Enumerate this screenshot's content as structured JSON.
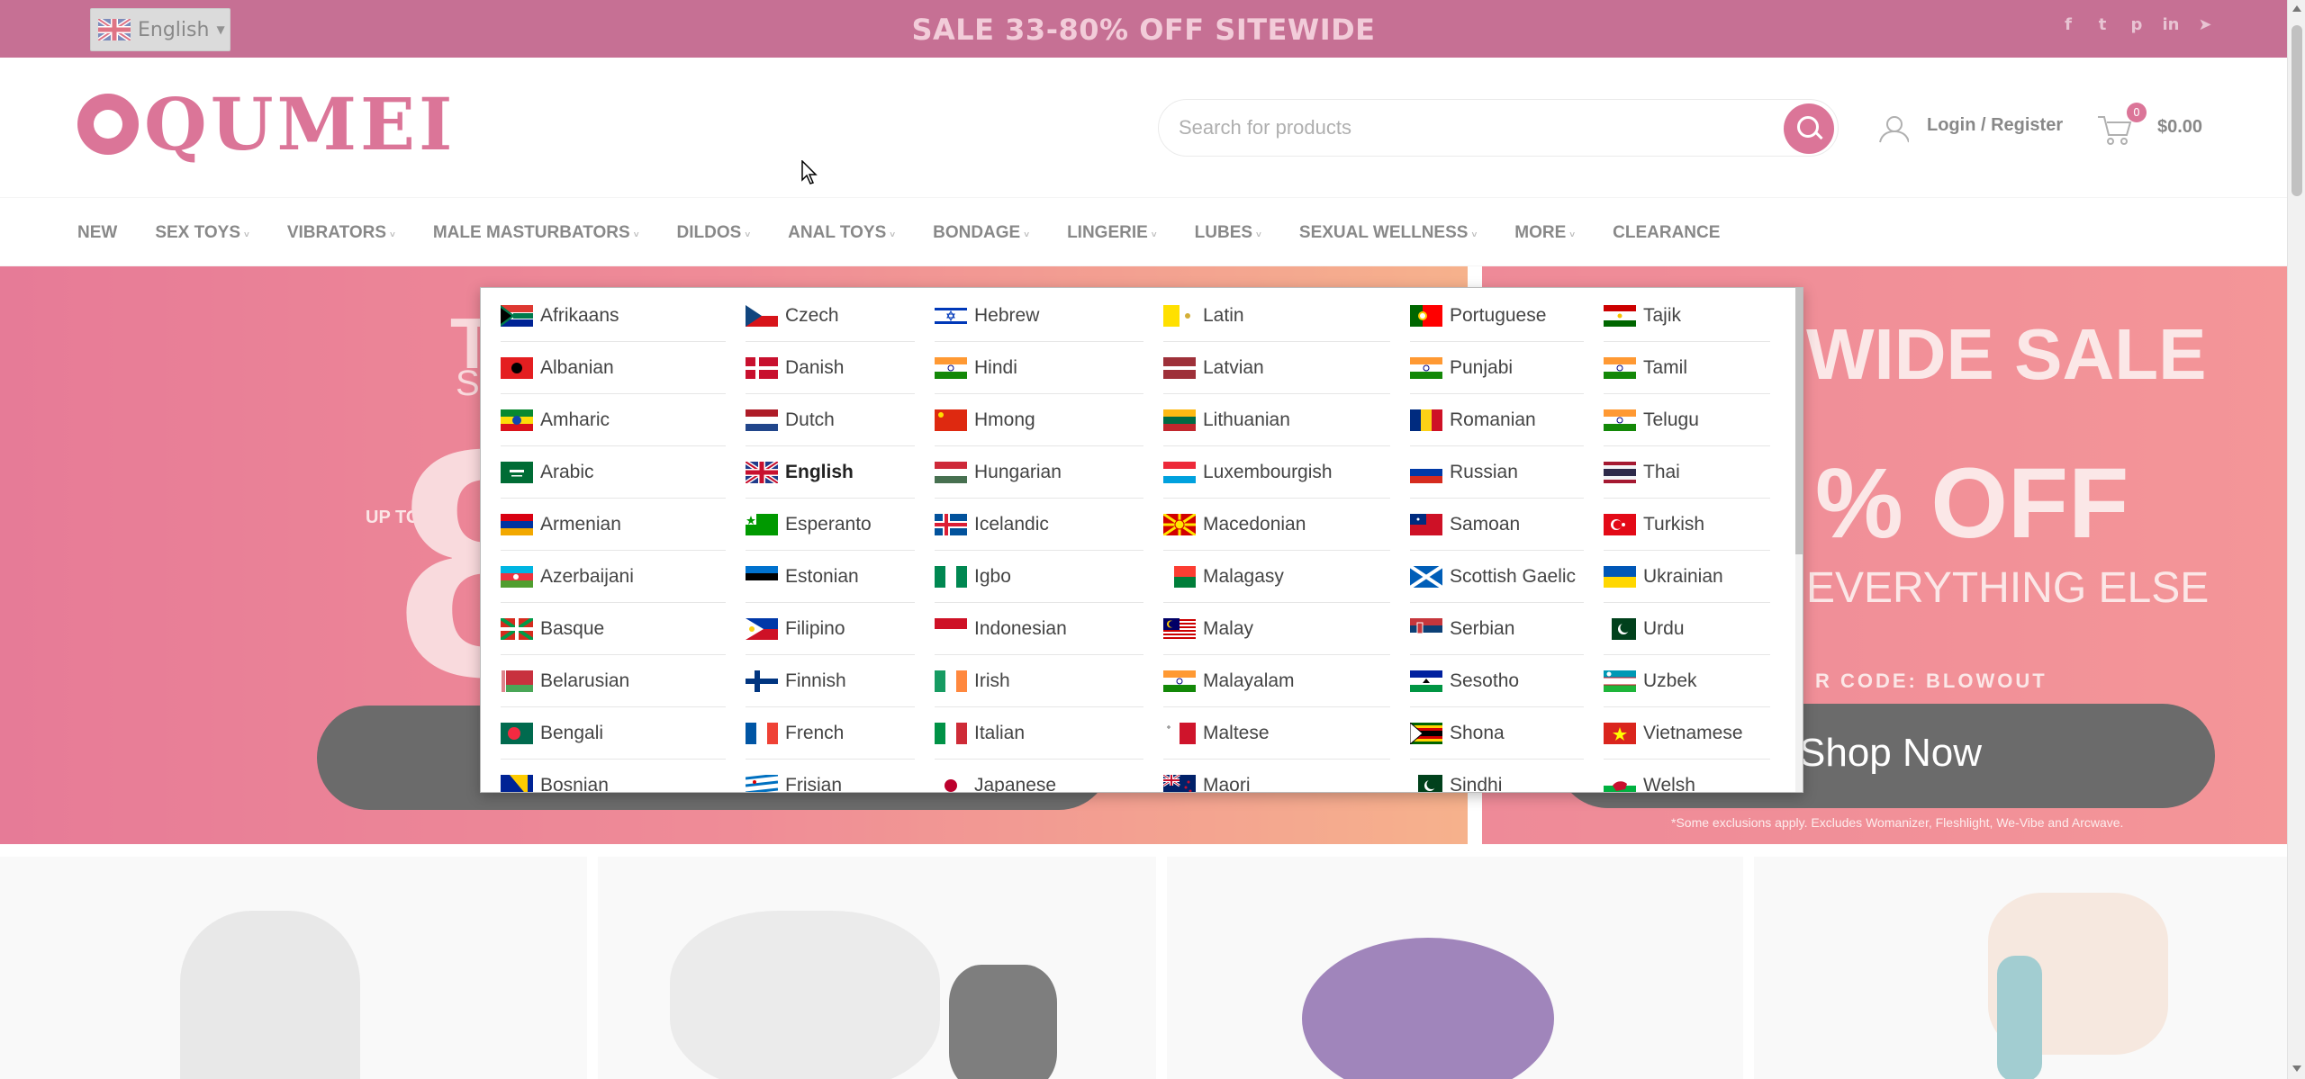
{
  "topbar": {
    "language_selector": "English",
    "promo": "SALE 33-80% OFF SITEWIDE",
    "social_icons": [
      "facebook-icon",
      "twitter-icon",
      "pinterest-icon",
      "linkedin-icon",
      "telegram-icon"
    ],
    "social_glyphs": [
      "f",
      "t",
      "p",
      "in",
      "➤"
    ]
  },
  "header": {
    "logo_text": "QUMEI",
    "search_placeholder": "Search for products",
    "login_label": "Login / Register",
    "cart_count": "0",
    "cart_total": "$0.00"
  },
  "nav": {
    "items": [
      {
        "label": "NEW",
        "has_dropdown": false
      },
      {
        "label": "SEX TOYS",
        "has_dropdown": true
      },
      {
        "label": "VIBRATORS",
        "has_dropdown": true
      },
      {
        "label": "MALE MASTURBATORS",
        "has_dropdown": true
      },
      {
        "label": "DILDOS",
        "has_dropdown": true
      },
      {
        "label": "ANAL TOYS",
        "has_dropdown": true
      },
      {
        "label": "BONDAGE",
        "has_dropdown": true
      },
      {
        "label": "LINGERIE",
        "has_dropdown": true
      },
      {
        "label": "LUBES",
        "has_dropdown": true
      },
      {
        "label": "SEXUAL WELLNESS",
        "has_dropdown": true
      },
      {
        "label": "MORE",
        "has_dropdown": true
      },
      {
        "label": "CLEARANCE",
        "has_dropdown": false
      }
    ]
  },
  "hero": {
    "left": {
      "up_to": "UP TO",
      "big_digit": "8",
      "t_letter": "T",
      "s_letter": "S"
    },
    "right": {
      "headline": "WIDE SALE",
      "off": "% OFF",
      "subline": "EVERYTHING ELSE",
      "code_label": "R CODE: BLOWOUT",
      "button": "Shop Now",
      "disclaimer": "*Some exclusions apply. Excludes Womanizer, Fleshlight, We-Vibe and Arcwave."
    }
  },
  "language_dropdown": {
    "selected": "English",
    "columns": [
      [
        {
          "label": "Afrikaans",
          "flag": "za"
        },
        {
          "label": "Albanian",
          "flag": "al"
        },
        {
          "label": "Amharic",
          "flag": "et"
        },
        {
          "label": "Arabic",
          "flag": "sa"
        },
        {
          "label": "Armenian",
          "flag": "am"
        },
        {
          "label": "Azerbaijani",
          "flag": "az"
        },
        {
          "label": "Basque",
          "flag": "eus"
        },
        {
          "label": "Belarusian",
          "flag": "by"
        },
        {
          "label": "Bengali",
          "flag": "bd"
        },
        {
          "label": "Bosnian",
          "flag": "ba"
        }
      ],
      [
        {
          "label": "Czech",
          "flag": "cz"
        },
        {
          "label": "Danish",
          "flag": "dk"
        },
        {
          "label": "Dutch",
          "flag": "nl"
        },
        {
          "label": "English",
          "flag": "gb"
        },
        {
          "label": "Esperanto",
          "flag": "eo"
        },
        {
          "label": "Estonian",
          "flag": "ee"
        },
        {
          "label": "Filipino",
          "flag": "ph"
        },
        {
          "label": "Finnish",
          "flag": "fi"
        },
        {
          "label": "French",
          "flag": "fr"
        },
        {
          "label": "Frisian",
          "flag": "fy"
        }
      ],
      [
        {
          "label": "Hebrew",
          "flag": "il"
        },
        {
          "label": "Hindi",
          "flag": "in"
        },
        {
          "label": "Hmong",
          "flag": "cn"
        },
        {
          "label": "Hungarian",
          "flag": "hu"
        },
        {
          "label": "Icelandic",
          "flag": "is"
        },
        {
          "label": "Igbo",
          "flag": "ng"
        },
        {
          "label": "Indonesian",
          "flag": "id"
        },
        {
          "label": "Irish",
          "flag": "ie"
        },
        {
          "label": "Italian",
          "flag": "it"
        },
        {
          "label": "Japanese",
          "flag": "jp"
        }
      ],
      [
        {
          "label": "Latin",
          "flag": "va"
        },
        {
          "label": "Latvian",
          "flag": "lv"
        },
        {
          "label": "Lithuanian",
          "flag": "lt"
        },
        {
          "label": "Luxembourgish",
          "flag": "lu"
        },
        {
          "label": "Macedonian",
          "flag": "mk"
        },
        {
          "label": "Malagasy",
          "flag": "mg"
        },
        {
          "label": "Malay",
          "flag": "my"
        },
        {
          "label": "Malayalam",
          "flag": "in"
        },
        {
          "label": "Maltese",
          "flag": "mt"
        },
        {
          "label": "Maori",
          "flag": "nz"
        }
      ],
      [
        {
          "label": "Portuguese",
          "flag": "pt"
        },
        {
          "label": "Punjabi",
          "flag": "in"
        },
        {
          "label": "Romanian",
          "flag": "ro"
        },
        {
          "label": "Russian",
          "flag": "ru"
        },
        {
          "label": "Samoan",
          "flag": "ws"
        },
        {
          "label": "Scottish Gaelic",
          "flag": "sco"
        },
        {
          "label": "Serbian",
          "flag": "rs"
        },
        {
          "label": "Sesotho",
          "flag": "ls"
        },
        {
          "label": "Shona",
          "flag": "zw"
        },
        {
          "label": "Sindhi",
          "flag": "pk"
        }
      ],
      [
        {
          "label": "Tajik",
          "flag": "tj"
        },
        {
          "label": "Tamil",
          "flag": "in"
        },
        {
          "label": "Telugu",
          "flag": "in"
        },
        {
          "label": "Thai",
          "flag": "th"
        },
        {
          "label": "Turkish",
          "flag": "tr"
        },
        {
          "label": "Ukrainian",
          "flag": "ua"
        },
        {
          "label": "Urdu",
          "flag": "pk"
        },
        {
          "label": "Uzbek",
          "flag": "uz"
        },
        {
          "label": "Vietnamese",
          "flag": "vn"
        },
        {
          "label": "Welsh",
          "flag": "wls"
        }
      ]
    ]
  },
  "colors": {
    "brand": "#c1124f",
    "topbar": "#9d0a47",
    "hero_left": "#e4394c",
    "hero_right": "#ec4a4f"
  }
}
